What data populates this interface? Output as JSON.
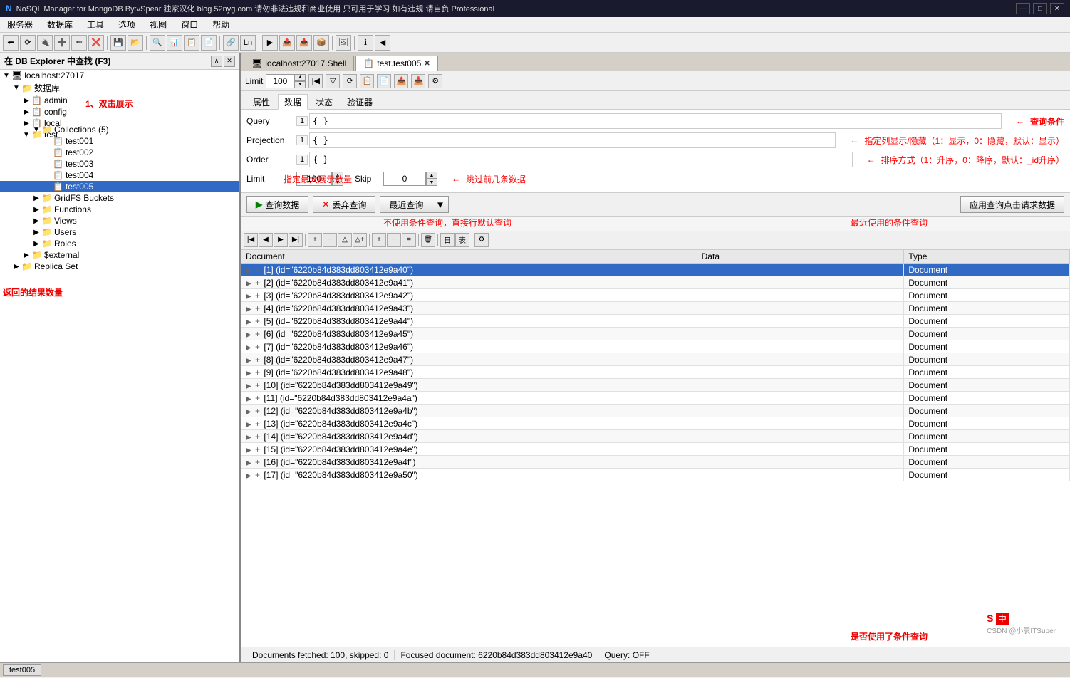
{
  "titleBar": {
    "title": "NoSQL Manager for MongoDB By:vSpear 独家汉化 blog.52nyg.com 请勿非法违规和商业使用 只可用于学习 如有违规 请自负  Professional",
    "minBtn": "—",
    "maxBtn": "□",
    "closeBtn": "✕"
  },
  "menuBar": {
    "items": [
      "服务器",
      "数据库",
      "工具",
      "选项",
      "视图",
      "窗口",
      "帮助"
    ]
  },
  "leftPanel": {
    "headerTitle": "在 DB Explorer 中查找 (F3)",
    "tree": [
      {
        "id": "localhost",
        "label": "localhost:27017",
        "level": 0,
        "icon": "🖥",
        "expanded": true
      },
      {
        "id": "databases",
        "label": "数据库",
        "level": 1,
        "icon": "📁",
        "expanded": true
      },
      {
        "id": "admin",
        "label": "admin",
        "level": 2,
        "icon": "📋",
        "expanded": false
      },
      {
        "id": "config",
        "label": "config",
        "level": 2,
        "icon": "📋",
        "expanded": false
      },
      {
        "id": "local",
        "label": "local",
        "level": 2,
        "icon": "📋",
        "expanded": false
      },
      {
        "id": "test",
        "label": "test",
        "level": 2,
        "icon": "📁",
        "expanded": true
      },
      {
        "id": "collections",
        "label": "Collections (5)",
        "level": 3,
        "icon": "📁",
        "expanded": true
      },
      {
        "id": "test001",
        "label": "test001",
        "level": 4,
        "icon": "📋"
      },
      {
        "id": "test002",
        "label": "test002",
        "level": 4,
        "icon": "📋"
      },
      {
        "id": "test003",
        "label": "test003",
        "level": 4,
        "icon": "📋"
      },
      {
        "id": "test004",
        "label": "test004",
        "level": 4,
        "icon": "📋"
      },
      {
        "id": "test005",
        "label": "test005",
        "level": 4,
        "icon": "📋",
        "selected": true
      },
      {
        "id": "gridfs",
        "label": "GridFS Buckets",
        "level": 3,
        "icon": "📁"
      },
      {
        "id": "functions",
        "label": "Functions",
        "level": 3,
        "icon": "📁"
      },
      {
        "id": "views",
        "label": "Views",
        "level": 3,
        "icon": "📁"
      },
      {
        "id": "users",
        "label": "Users",
        "level": 3,
        "icon": "📁"
      },
      {
        "id": "roles",
        "label": "Roles",
        "level": 3,
        "icon": "📁"
      },
      {
        "id": "external",
        "label": "$external",
        "level": 2,
        "icon": "📁"
      },
      {
        "id": "replicaset",
        "label": "Replica Set",
        "level": 1,
        "icon": "📁"
      }
    ],
    "annotation1": "1、双击展示"
  },
  "rightPanel": {
    "tabs": [
      {
        "id": "shell",
        "label": "localhost:27017.Shell",
        "icon": "🖥",
        "active": false,
        "closable": false
      },
      {
        "id": "test005",
        "label": "test.test005",
        "icon": "📋",
        "active": true,
        "closable": true
      }
    ],
    "queryToolbar": {
      "limitLabel": "Limit",
      "limitValue": "100",
      "skipLabel": "Skip",
      "skipValue": "0"
    },
    "propsTabs": [
      "属性",
      "数据",
      "状态",
      "验证器"
    ],
    "activePropsTab": "数据",
    "queryForm": {
      "queryLabel": "Query",
      "queryNum": "1",
      "queryValue": "{ }",
      "projLabel": "Projection",
      "projNum": "1",
      "projValue": "{ }",
      "orderLabel": "Order",
      "orderNum": "1",
      "orderValue": "{ }",
      "limitLabel": "Limit",
      "limitValue": "100",
      "skipLabel": "Skip",
      "skipValue": "0"
    },
    "annotations": {
      "queryCondition": "查询条件",
      "projectionHint": "指定列显示/隐藏（1：显示，0：隐藏，默认：显示）",
      "orderHint": "排序方式（1：升序，0：降序，默认：_id升序）",
      "skipHint": "跳过前几条数据",
      "limitHint": "指定最大展示数量",
      "noConditionHint": "不使用条件查询，直接行默认查询",
      "recentHint": "最近使用的条件查询",
      "returnCountHint": "返回的结果数量",
      "conditionUsedHint": "是否使用了条件查询"
    },
    "actionButtons": {
      "query": "查询数据",
      "cancel": "丢弃查询",
      "recent": "最近查询",
      "apply": "应用查询点击请求数据"
    },
    "gridToolbarBtns": [
      "◀◀",
      "◀",
      "▶",
      "▶▶",
      "+",
      "−",
      "△",
      "△+",
      "+",
      "−",
      "=",
      "🗑",
      "日",
      "表",
      "⚙"
    ],
    "tableHeaders": [
      "Document",
      "Data",
      "Type"
    ],
    "tableData": [
      {
        "index": 1,
        "doc": "[1] (id=\"6220b84d383dd803412e9a40\")",
        "type": "Document",
        "selected": true
      },
      {
        "index": 2,
        "doc": "[2] (id=\"6220b84d383dd803412e9a41\")",
        "type": "Document"
      },
      {
        "index": 3,
        "doc": "[3] (id=\"6220b84d383dd803412e9a42\")",
        "type": "Document"
      },
      {
        "index": 4,
        "doc": "[4] (id=\"6220b84d383dd803412e9a43\")",
        "type": "Document"
      },
      {
        "index": 5,
        "doc": "[5] (id=\"6220b84d383dd803412e9a44\")",
        "type": "Document"
      },
      {
        "index": 6,
        "doc": "[6] (id=\"6220b84d383dd803412e9a45\")",
        "type": "Document"
      },
      {
        "index": 7,
        "doc": "[7] (id=\"6220b84d383dd803412e9a46\")",
        "type": "Document"
      },
      {
        "index": 8,
        "doc": "[8] (id=\"6220b84d383dd803412e9a47\")",
        "type": "Document"
      },
      {
        "index": 9,
        "doc": "[9] (id=\"6220b84d383dd803412e9a48\")",
        "type": "Document"
      },
      {
        "index": 10,
        "doc": "[10] (id=\"6220b84d383dd803412e9a49\")",
        "type": "Document"
      },
      {
        "index": 11,
        "doc": "[11] (id=\"6220b84d383dd803412e9a4a\")",
        "type": "Document"
      },
      {
        "index": 12,
        "doc": "[12] (id=\"6220b84d383dd803412e9a4b\")",
        "type": "Document"
      },
      {
        "index": 13,
        "doc": "[13] (id=\"6220b84d383dd803412e9a4c\")",
        "type": "Document"
      },
      {
        "index": 14,
        "doc": "[14] (id=\"6220b84d383dd803412e9a4d\")",
        "type": "Document"
      },
      {
        "index": 15,
        "doc": "[15] (id=\"6220b84d383dd803412e9a4e\")",
        "type": "Document"
      },
      {
        "index": 16,
        "doc": "[16] (id=\"6220b84d383dd803412e9a4f\")",
        "type": "Document"
      },
      {
        "index": 17,
        "doc": "[17] (id=\"6220b84d383dd803412e9a50\")",
        "type": "Document"
      }
    ],
    "statusBar": {
      "docs": "Documents fetched: 100, skipped: 0",
      "focused": "Focused document: 6220b84d383dd803412e9a40",
      "query": "Query: OFF"
    }
  },
  "bottomTab": {
    "label": "test005"
  },
  "watermark": {
    "brand": "CSDN @小袁ITSuper"
  }
}
